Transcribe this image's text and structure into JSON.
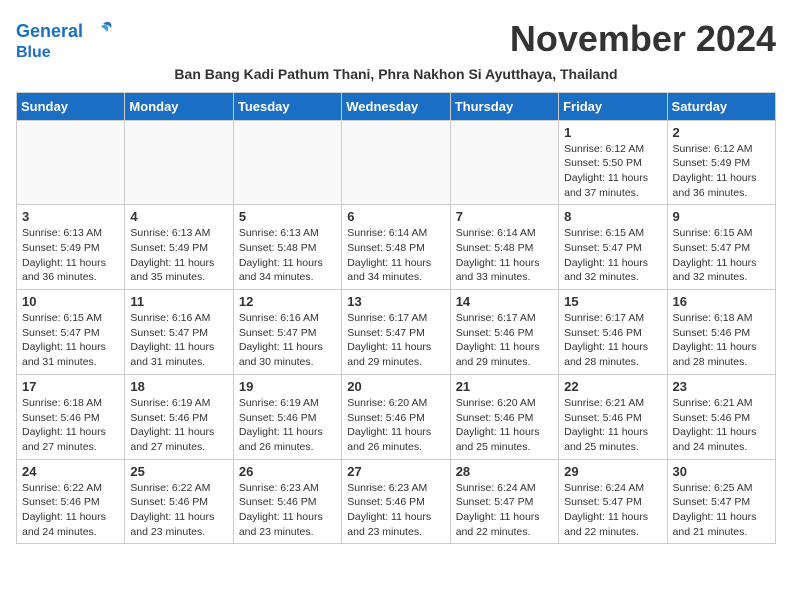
{
  "header": {
    "logo_line1": "General",
    "logo_line2": "Blue",
    "month_title": "November 2024",
    "subtitle": "Ban Bang Kadi Pathum Thani, Phra Nakhon Si Ayutthaya, Thailand"
  },
  "weekdays": [
    "Sunday",
    "Monday",
    "Tuesday",
    "Wednesday",
    "Thursday",
    "Friday",
    "Saturday"
  ],
  "weeks": [
    {
      "days": [
        {
          "number": "",
          "info": "",
          "empty": true
        },
        {
          "number": "",
          "info": "",
          "empty": true
        },
        {
          "number": "",
          "info": "",
          "empty": true
        },
        {
          "number": "",
          "info": "",
          "empty": true
        },
        {
          "number": "",
          "info": "",
          "empty": true
        },
        {
          "number": "1",
          "info": "Sunrise: 6:12 AM\nSunset: 5:50 PM\nDaylight: 11 hours\nand 37 minutes.",
          "empty": false
        },
        {
          "number": "2",
          "info": "Sunrise: 6:12 AM\nSunset: 5:49 PM\nDaylight: 11 hours\nand 36 minutes.",
          "empty": false
        }
      ]
    },
    {
      "days": [
        {
          "number": "3",
          "info": "Sunrise: 6:13 AM\nSunset: 5:49 PM\nDaylight: 11 hours\nand 36 minutes.",
          "empty": false
        },
        {
          "number": "4",
          "info": "Sunrise: 6:13 AM\nSunset: 5:49 PM\nDaylight: 11 hours\nand 35 minutes.",
          "empty": false
        },
        {
          "number": "5",
          "info": "Sunrise: 6:13 AM\nSunset: 5:48 PM\nDaylight: 11 hours\nand 34 minutes.",
          "empty": false
        },
        {
          "number": "6",
          "info": "Sunrise: 6:14 AM\nSunset: 5:48 PM\nDaylight: 11 hours\nand 34 minutes.",
          "empty": false
        },
        {
          "number": "7",
          "info": "Sunrise: 6:14 AM\nSunset: 5:48 PM\nDaylight: 11 hours\nand 33 minutes.",
          "empty": false
        },
        {
          "number": "8",
          "info": "Sunrise: 6:15 AM\nSunset: 5:47 PM\nDaylight: 11 hours\nand 32 minutes.",
          "empty": false
        },
        {
          "number": "9",
          "info": "Sunrise: 6:15 AM\nSunset: 5:47 PM\nDaylight: 11 hours\nand 32 minutes.",
          "empty": false
        }
      ]
    },
    {
      "days": [
        {
          "number": "10",
          "info": "Sunrise: 6:15 AM\nSunset: 5:47 PM\nDaylight: 11 hours\nand 31 minutes.",
          "empty": false
        },
        {
          "number": "11",
          "info": "Sunrise: 6:16 AM\nSunset: 5:47 PM\nDaylight: 11 hours\nand 31 minutes.",
          "empty": false
        },
        {
          "number": "12",
          "info": "Sunrise: 6:16 AM\nSunset: 5:47 PM\nDaylight: 11 hours\nand 30 minutes.",
          "empty": false
        },
        {
          "number": "13",
          "info": "Sunrise: 6:17 AM\nSunset: 5:47 PM\nDaylight: 11 hours\nand 29 minutes.",
          "empty": false
        },
        {
          "number": "14",
          "info": "Sunrise: 6:17 AM\nSunset: 5:46 PM\nDaylight: 11 hours\nand 29 minutes.",
          "empty": false
        },
        {
          "number": "15",
          "info": "Sunrise: 6:17 AM\nSunset: 5:46 PM\nDaylight: 11 hours\nand 28 minutes.",
          "empty": false
        },
        {
          "number": "16",
          "info": "Sunrise: 6:18 AM\nSunset: 5:46 PM\nDaylight: 11 hours\nand 28 minutes.",
          "empty": false
        }
      ]
    },
    {
      "days": [
        {
          "number": "17",
          "info": "Sunrise: 6:18 AM\nSunset: 5:46 PM\nDaylight: 11 hours\nand 27 minutes.",
          "empty": false
        },
        {
          "number": "18",
          "info": "Sunrise: 6:19 AM\nSunset: 5:46 PM\nDaylight: 11 hours\nand 27 minutes.",
          "empty": false
        },
        {
          "number": "19",
          "info": "Sunrise: 6:19 AM\nSunset: 5:46 PM\nDaylight: 11 hours\nand 26 minutes.",
          "empty": false
        },
        {
          "number": "20",
          "info": "Sunrise: 6:20 AM\nSunset: 5:46 PM\nDaylight: 11 hours\nand 26 minutes.",
          "empty": false
        },
        {
          "number": "21",
          "info": "Sunrise: 6:20 AM\nSunset: 5:46 PM\nDaylight: 11 hours\nand 25 minutes.",
          "empty": false
        },
        {
          "number": "22",
          "info": "Sunrise: 6:21 AM\nSunset: 5:46 PM\nDaylight: 11 hours\nand 25 minutes.",
          "empty": false
        },
        {
          "number": "23",
          "info": "Sunrise: 6:21 AM\nSunset: 5:46 PM\nDaylight: 11 hours\nand 24 minutes.",
          "empty": false
        }
      ]
    },
    {
      "days": [
        {
          "number": "24",
          "info": "Sunrise: 6:22 AM\nSunset: 5:46 PM\nDaylight: 11 hours\nand 24 minutes.",
          "empty": false
        },
        {
          "number": "25",
          "info": "Sunrise: 6:22 AM\nSunset: 5:46 PM\nDaylight: 11 hours\nand 23 minutes.",
          "empty": false
        },
        {
          "number": "26",
          "info": "Sunrise: 6:23 AM\nSunset: 5:46 PM\nDaylight: 11 hours\nand 23 minutes.",
          "empty": false
        },
        {
          "number": "27",
          "info": "Sunrise: 6:23 AM\nSunset: 5:46 PM\nDaylight: 11 hours\nand 23 minutes.",
          "empty": false
        },
        {
          "number": "28",
          "info": "Sunrise: 6:24 AM\nSunset: 5:47 PM\nDaylight: 11 hours\nand 22 minutes.",
          "empty": false
        },
        {
          "number": "29",
          "info": "Sunrise: 6:24 AM\nSunset: 5:47 PM\nDaylight: 11 hours\nand 22 minutes.",
          "empty": false
        },
        {
          "number": "30",
          "info": "Sunrise: 6:25 AM\nSunset: 5:47 PM\nDaylight: 11 hours\nand 21 minutes.",
          "empty": false
        }
      ]
    }
  ]
}
